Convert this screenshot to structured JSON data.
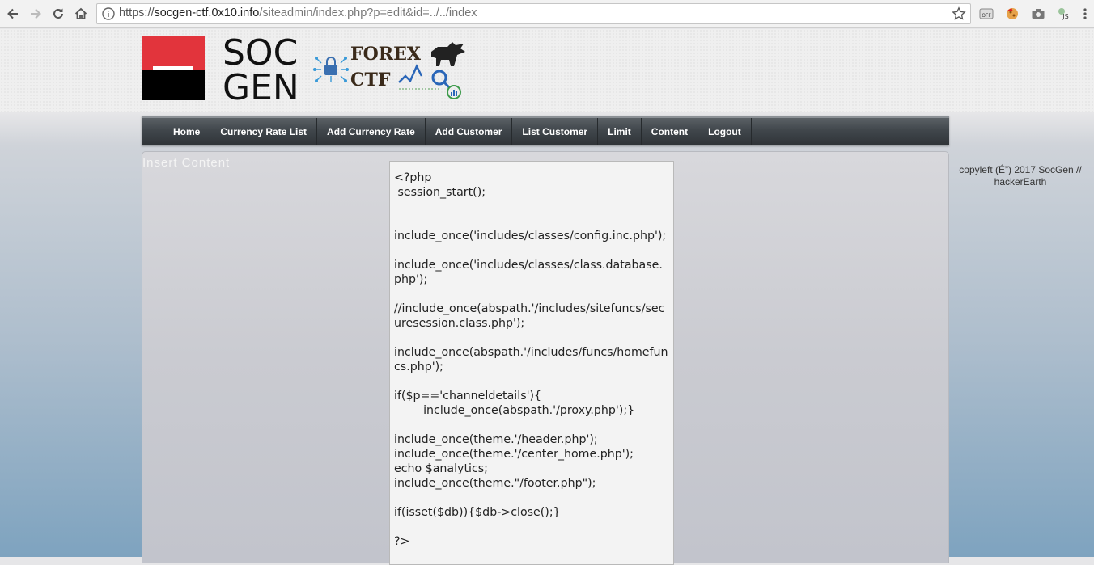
{
  "browser": {
    "url_scheme": "https://",
    "url_host": "socgen-ctf.0x10.info",
    "url_path": "/siteadmin/index.php?p=edit&id=../../index"
  },
  "logo": {
    "brand_line1": "SOC",
    "brand_line2": "GEN",
    "tag_line1": "FOREX",
    "tag_line2": "CTF"
  },
  "nav": {
    "items": [
      "Home",
      "Currency Rate List",
      "Add Currency Rate",
      "Add Customer",
      "List Customer",
      "Limit",
      "Content",
      "Logout"
    ]
  },
  "panel": {
    "title": "Insert Content"
  },
  "editor": {
    "content": "<?php\n session_start();\n\n\ninclude_once('includes/classes/config.inc.php');\n\ninclude_once('includes/classes/class.database.php');\n\n//include_once(abspath.'/includes/sitefuncs/securesession.class.php');\n\ninclude_once(abspath.'/includes/funcs/homefuncs.php');\n\nif($p=='channeldetails'){\n        include_once(abspath.'/proxy.php');}\n\ninclude_once(theme.'/header.php');\ninclude_once(theme.'/center_home.php');\necho $analytics;\ninclude_once(theme.\"/footer.php\");\n\nif(isset($db)){$db->close();}\n\n?>"
  },
  "footer": {
    "text": "copyleft (É”) 2017 SocGen // hackerEarth"
  },
  "colors": {
    "brand_red": "#e2343c",
    "nav_dark": "#40464b"
  }
}
